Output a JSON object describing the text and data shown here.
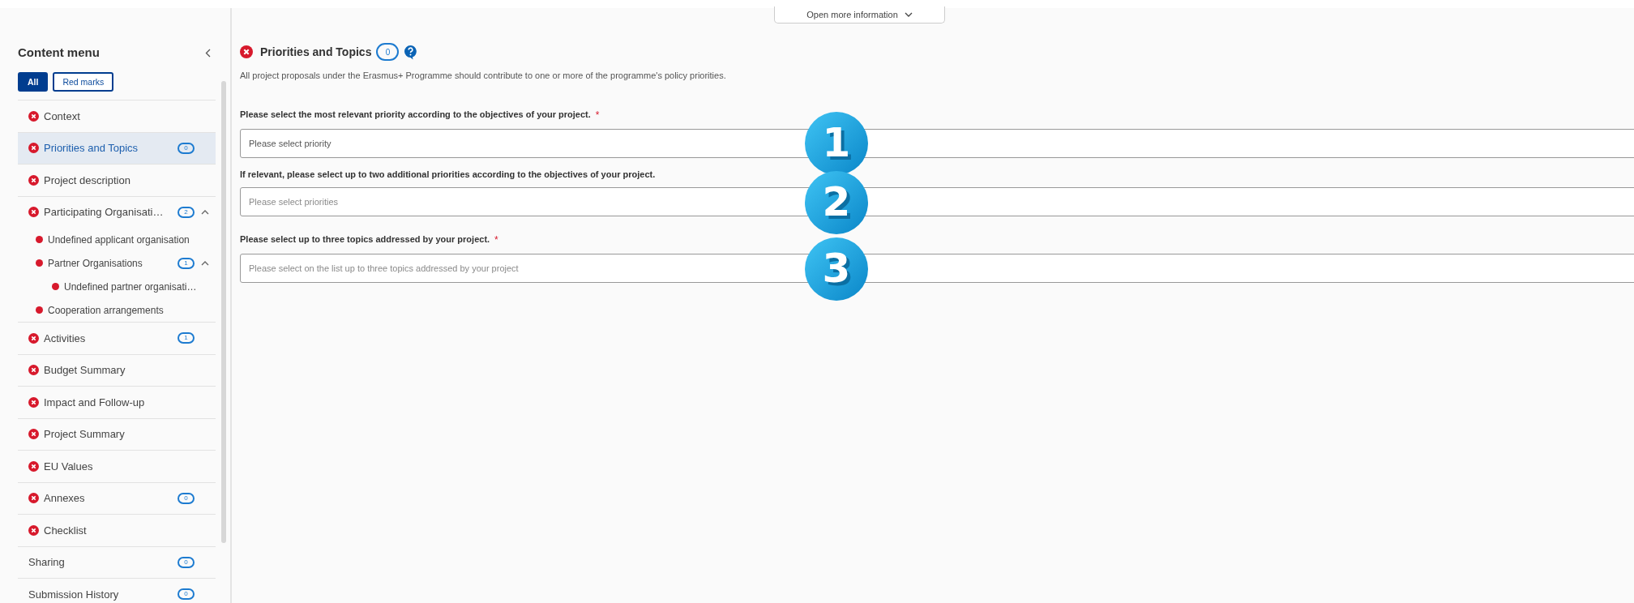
{
  "top_bar": {
    "more_button": "Open more information"
  },
  "sidebar": {
    "title": "Content menu",
    "filters": [
      {
        "label": "All",
        "selected": true
      },
      {
        "label": "Red marks",
        "selected": false
      }
    ],
    "items": [
      {
        "kind": "error",
        "label": "Context",
        "selected": false
      },
      {
        "kind": "error",
        "label": "Priorities and Topics",
        "selected": true,
        "count": "0"
      },
      {
        "kind": "error",
        "label": "Project description",
        "selected": false
      },
      {
        "kind": "error",
        "label": "Participating Organisati…",
        "selected": false,
        "count": "2",
        "expanded": true,
        "children": [
          {
            "kind": "dot",
            "label": "Undefined applicant organisation",
            "selected": false
          },
          {
            "kind": "dot",
            "label": "Partner Organisations",
            "selected": false,
            "count": "1",
            "expanded": true,
            "children": [
              {
                "kind": "dot",
                "label": "Undefined partner organisati…",
                "selected": false
              }
            ]
          },
          {
            "kind": "dot",
            "label": "Cooperation arrangements",
            "selected": false
          }
        ]
      },
      {
        "kind": "error",
        "label": "Activities",
        "selected": false,
        "count": "1"
      },
      {
        "kind": "error",
        "label": "Budget Summary",
        "selected": false
      },
      {
        "kind": "error",
        "label": "Impact and Follow-up",
        "selected": false
      },
      {
        "kind": "error",
        "label": "Project Summary",
        "selected": false
      },
      {
        "kind": "error",
        "label": "EU Values",
        "selected": false
      },
      {
        "kind": "error",
        "label": "Annexes",
        "selected": false,
        "count": "0"
      },
      {
        "kind": "error",
        "label": "Checklist",
        "selected": false
      },
      {
        "kind": "plain",
        "label": "Sharing",
        "selected": false,
        "count": "0"
      },
      {
        "kind": "plain",
        "label": "Submission History",
        "selected": false,
        "count": "0"
      }
    ]
  },
  "section": {
    "title": "Priorities and Topics",
    "count": "0",
    "description": "All project proposals under the Erasmus+ Programme should contribute to one or more of the programme's policy priorities.",
    "fields": [
      {
        "label": "Please select the most relevant priority according to the objectives of your project.",
        "required_mark": "*",
        "placeholder": "Please select priority",
        "callout": "1"
      },
      {
        "label": "If relevant, please select up to two additional priorities according to the objectives of your project.",
        "placeholder": "Please select priorities",
        "callout": "2"
      },
      {
        "label": "Please select up to three topics addressed by your project.",
        "required_mark": "*",
        "placeholder": "Please select on the list up to three topics addressed by your project",
        "callout": "3"
      }
    ]
  }
}
